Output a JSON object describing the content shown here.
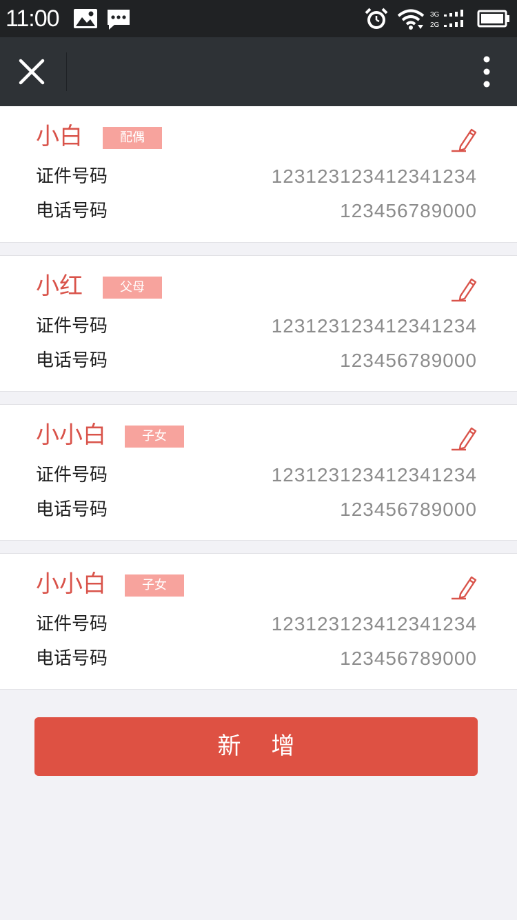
{
  "status_bar": {
    "time": "11:00",
    "icons": [
      "image-icon",
      "message-icon",
      "alarm-icon",
      "wifi-icon",
      "signal-icon",
      "battery-icon"
    ],
    "network_labels": [
      "3G",
      "2G"
    ]
  },
  "nav": {
    "close_icon": "close-icon",
    "more_icon": "more-vertical-icon"
  },
  "cards": [
    {
      "name": "小白",
      "relation": "配偶",
      "id_label": "证件号码",
      "id_value": "123123123412341234",
      "phone_label": "电话号码",
      "phone_value": "123456789000"
    },
    {
      "name": "小红",
      "relation": "父母",
      "id_label": "证件号码",
      "id_value": "123123123412341234",
      "phone_label": "电话号码",
      "phone_value": "123456789000"
    },
    {
      "name": "小小白",
      "relation": "子女",
      "id_label": "证件号码",
      "id_value": "123123123412341234",
      "phone_label": "电话号码",
      "phone_value": "123456789000"
    },
    {
      "name": "小小白",
      "relation": "子女",
      "id_label": "证件号码",
      "id_value": "123123123412341234",
      "phone_label": "电话号码",
      "phone_value": "123456789000"
    }
  ],
  "add_button": {
    "label": "新增"
  },
  "colors": {
    "accent": "#de5143",
    "name_text": "#d9534a",
    "tag_bg": "#f7a39d",
    "nav_bg": "#2e3236",
    "status_bg": "#202224",
    "page_bg": "#f2f2f6"
  }
}
